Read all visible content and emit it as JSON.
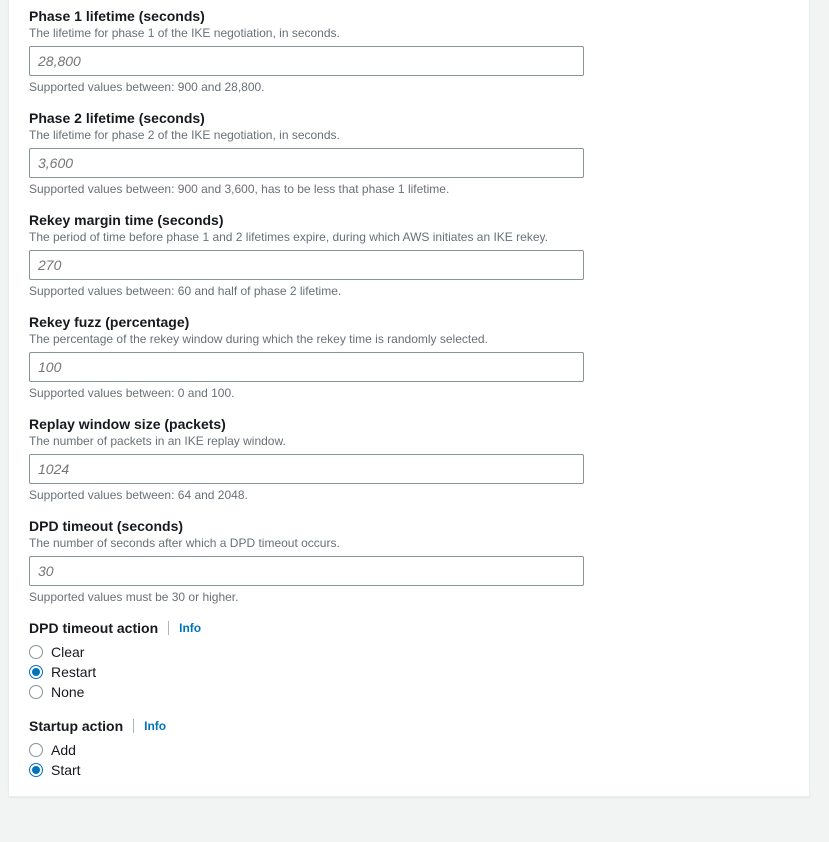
{
  "phase1": {
    "label": "Phase 1 lifetime (seconds)",
    "desc": "The lifetime for phase 1 of the IKE negotiation, in seconds.",
    "placeholder": "28,800",
    "hint": "Supported values between: 900 and 28,800."
  },
  "phase2": {
    "label": "Phase 2 lifetime (seconds)",
    "desc": "The lifetime for phase 2 of the IKE negotiation, in seconds.",
    "placeholder": "3,600",
    "hint": "Supported values between: 900 and 3,600, has to be less that phase 1 lifetime."
  },
  "rekeyMargin": {
    "label": "Rekey margin time (seconds)",
    "desc": "The period of time before phase 1 and 2 lifetimes expire, during which AWS initiates an IKE rekey.",
    "placeholder": "270",
    "hint": "Supported values between: 60 and half of phase 2 lifetime."
  },
  "rekeyFuzz": {
    "label": "Rekey fuzz (percentage)",
    "desc": "The percentage of the rekey window during which the rekey time is randomly selected.",
    "placeholder": "100",
    "hint": "Supported values between: 0 and 100."
  },
  "replayWindow": {
    "label": "Replay window size (packets)",
    "desc": "The number of packets in an IKE replay window.",
    "placeholder": "1024",
    "hint": "Supported values between: 64 and 2048."
  },
  "dpdTimeout": {
    "label": "DPD timeout (seconds)",
    "desc": "The number of seconds after which a DPD timeout occurs.",
    "placeholder": "30",
    "hint": "Supported values must be 30 or higher."
  },
  "dpdAction": {
    "label": "DPD timeout action",
    "info": "Info",
    "options": {
      "clear": "Clear",
      "restart": "Restart",
      "none": "None"
    }
  },
  "startupAction": {
    "label": "Startup action",
    "info": "Info",
    "options": {
      "add": "Add",
      "start": "Start"
    }
  }
}
